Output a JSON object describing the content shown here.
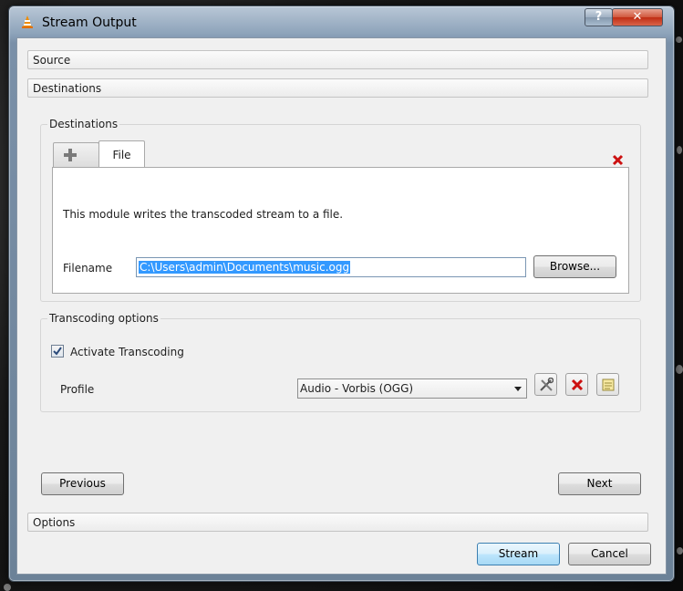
{
  "window": {
    "title": "Stream Output",
    "help_label": "?",
    "close_label": "✕"
  },
  "sections": {
    "source": "Source",
    "destinations": "Destinations",
    "options": "Options"
  },
  "destinations_group": {
    "title": "Destinations",
    "tabs": [
      {
        "icon": "plus-icon"
      },
      {
        "label": "File"
      }
    ],
    "remove_icon": "red-x-icon",
    "description": "This module writes the transcoded stream to a file.",
    "filename_label": "Filename",
    "filename_value": "C:\\Users\\admin\\Documents\\music.ogg",
    "browse_label": "Browse..."
  },
  "transcoding_group": {
    "title": "Transcoding options",
    "activate_label": "Activate Transcoding",
    "activate_checked": true,
    "profile_label": "Profile",
    "profile_selected": "Audio - Vorbis (OGG)",
    "profile_buttons": [
      "tools-icon",
      "delete-icon",
      "new-profile-icon"
    ]
  },
  "nav": {
    "previous": "Previous",
    "next": "Next"
  },
  "footer": {
    "stream": "Stream",
    "cancel": "Cancel"
  },
  "colors": {
    "accent": "#3399ff",
    "remove_red": "#cc1111"
  }
}
